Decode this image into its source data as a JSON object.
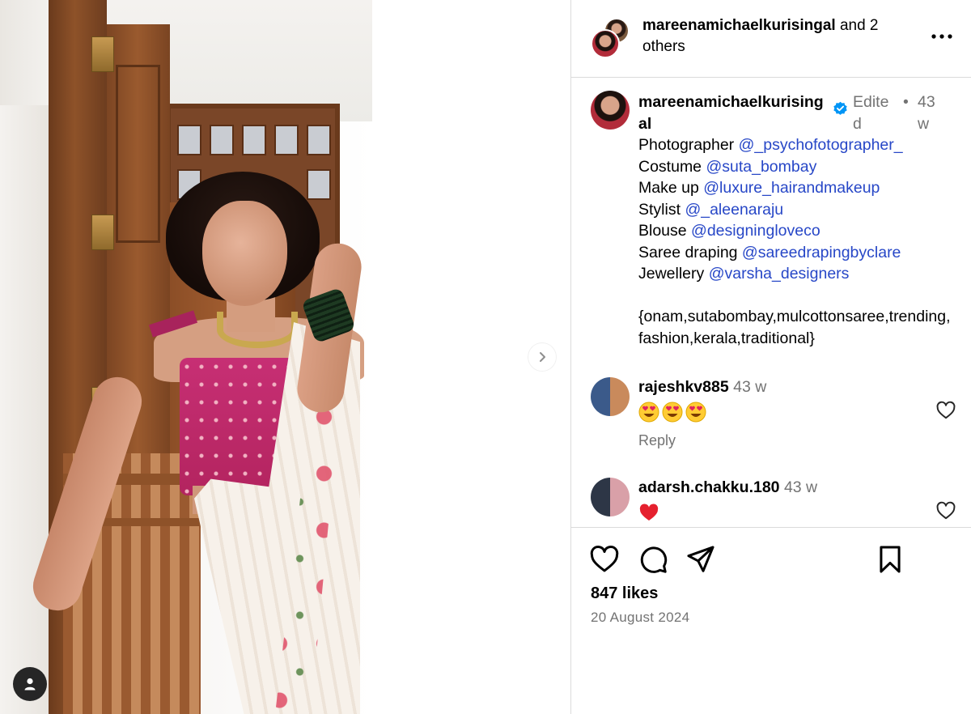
{
  "header": {
    "username": "mareenamichaelkurisingal",
    "suffix": " and 2 others"
  },
  "caption": {
    "username": "mareenamichaelkurisingal",
    "edited": "Edited",
    "separator": "•",
    "time": "43 w",
    "credits": [
      {
        "label": "Photographer ",
        "mention": "@_psychofotographer_"
      },
      {
        "label": "Costume ",
        "mention": "@suta_bombay"
      },
      {
        "label": "Make up ",
        "mention": "@luxure_hairandmakeup"
      },
      {
        "label": "Stylist ",
        "mention": "@_aleenaraju"
      },
      {
        "label": "Blouse ",
        "mention": "@designingloveco"
      },
      {
        "label": "Saree draping ",
        "mention": "@sareedrapingbyclare"
      },
      {
        "label": "Jewellery ",
        "mention": "@varsha_designers"
      }
    ],
    "hashtags": "{onam,sutabombay,mulcottonsaree,trending,fashion,kerala,traditional}"
  },
  "comments": [
    {
      "username": "rajeshkv885",
      "time": "43 w",
      "emojis": [
        "heart-eyes-emoji",
        "heart-eyes-emoji",
        "heart-eyes-emoji"
      ],
      "reply_label": "Reply"
    },
    {
      "username": "adarsh.chakku.180",
      "time": "43 w",
      "emojis": [
        "red-heart-emoji"
      ]
    }
  ],
  "footer": {
    "likes": "847 likes",
    "date": "20 August 2024"
  },
  "icons": [
    "chevron-right-icon",
    "person-icon",
    "more-icon",
    "verified-icon",
    "heart-icon",
    "comment-icon",
    "share-icon",
    "bookmark-icon"
  ],
  "colors": {
    "mention": "#2747c7",
    "muted": "#737373",
    "verified": "#0095f6",
    "heart": "#e0245e"
  }
}
